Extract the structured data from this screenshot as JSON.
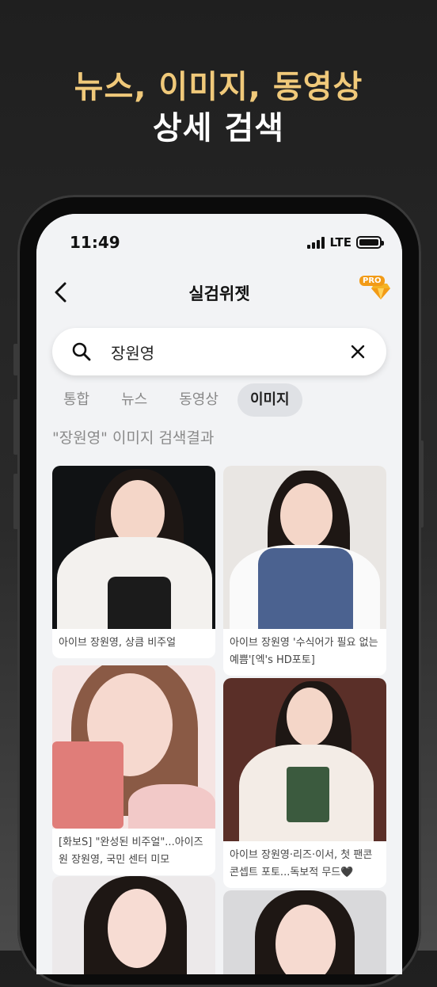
{
  "promo": {
    "line1": "뉴스, 이미지, 동영상",
    "line2": "상세 검색"
  },
  "status_bar": {
    "time": "11:49",
    "network": "LTE"
  },
  "appbar": {
    "title": "실검위젯",
    "pro_label": "PRO"
  },
  "search": {
    "value": "장원영",
    "placeholder": ""
  },
  "tabs": [
    {
      "label": "통합",
      "active": false
    },
    {
      "label": "뉴스",
      "active": false
    },
    {
      "label": "동영상",
      "active": false
    },
    {
      "label": "이미지",
      "active": true
    }
  ],
  "results_title": "\"장원영\" 이미지 검색결과",
  "results": [
    {
      "caption": "아이브 장원영, 상큼 비주얼"
    },
    {
      "caption": "아이브 장원영 '수식어가 필요 없는 예쁨'[엑's HD포토]"
    },
    {
      "caption": "[화보S] \"완성된 비주얼\"...아이즈원 장원영, 국민 센터 미모"
    },
    {
      "caption": "아이브 장원영·리즈·이서, 첫 팬콘 콘셉트 포토...독보적 무드🖤"
    },
    {
      "caption": ""
    },
    {
      "caption": ""
    }
  ],
  "colors": {
    "accent": "#f0c97a",
    "pro_badge": "#f29b17",
    "active_tab_bg": "#dfe1e5"
  }
}
